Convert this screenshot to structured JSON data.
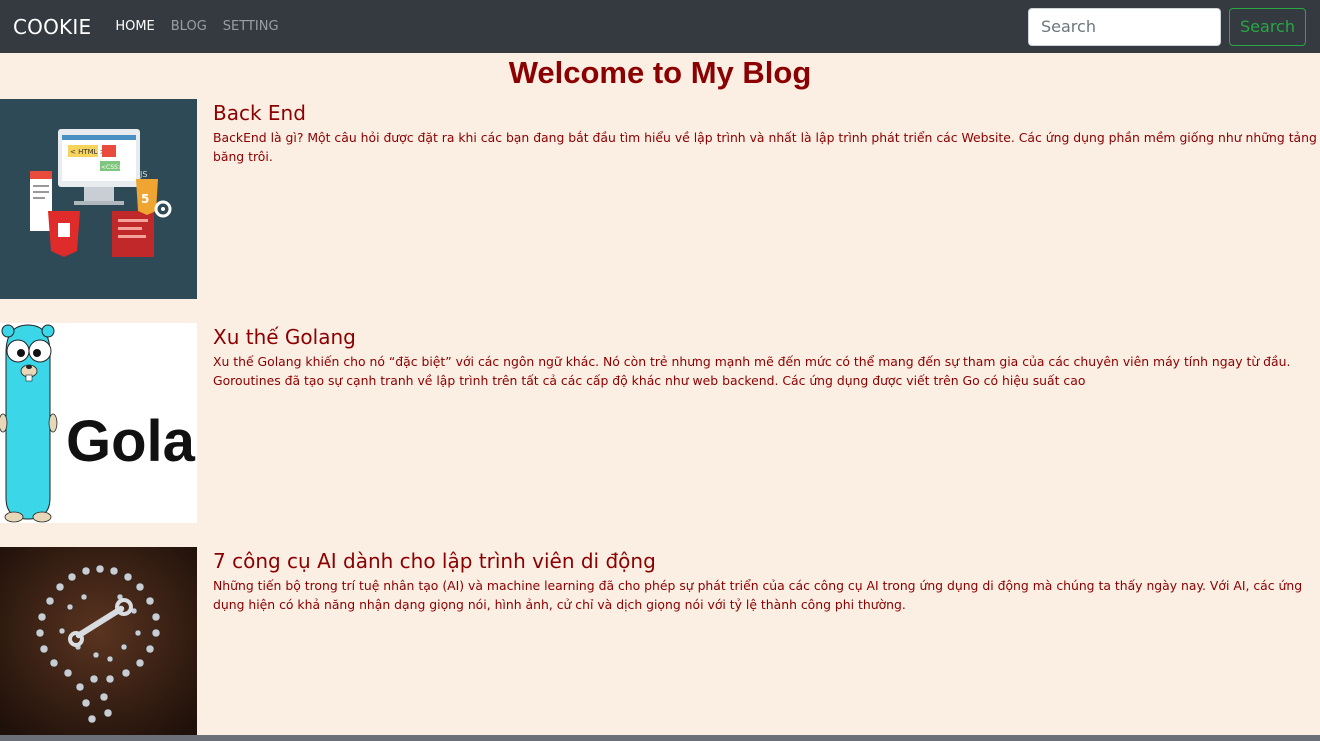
{
  "navbar": {
    "brand": "COOKIE",
    "links": [
      {
        "label": "HOME"
      },
      {
        "label": "BLOG"
      },
      {
        "label": "SETTING"
      }
    ],
    "search": {
      "placeholder": "Search",
      "button_label": "Search"
    }
  },
  "page_title": "Welcome to My Blog",
  "posts": [
    {
      "title": "Back End",
      "excerpt": "BackEnd là gì? Một câu hỏi được đặt ra khi các bạn đang bắt đầu tìm hiểu về lập trình và nhất là lập trình phát triển các Website. Các ứng dụng phần mềm giống như những tảng băng trôi.",
      "thumb_text": [
        "< HTML >",
        "<CSS>",
        "JS",
        "5"
      ]
    },
    {
      "title": "Xu thế Golang",
      "excerpt": "Xu thế Golang khiến cho nó “đặc biệt” với các ngôn ngữ khác. Nó còn trẻ nhưng mạnh mẽ đến mức có thể mang đến sự tham gia của các chuyên viên máy tính ngay từ đầu. Goroutines đã tạo sự cạnh tranh về lập trình trên tất cả các cấp độ khác như web backend. Các ứng dụng được viết trên Go có hiệu suất cao",
      "thumb_text": [
        "Golang"
      ]
    },
    {
      "title": "7 công cụ AI dành cho lập trình viên di động",
      "excerpt": "Những tiến bộ trong trí tuệ nhân tạo (AI) và machine learning đã cho phép sự phát triển của các công cụ AI trong ứng dụng di động mà chúng ta thấy ngày nay. Với AI, các ứng dụng hiện có khả năng nhận dạng giọng nói, hình ảnh, cử chỉ và dịch giọng nói với tỷ lệ thành công phi thường."
    }
  ],
  "colors": {
    "navbar_bg": "#343a40",
    "page_bg": "#fbeee3",
    "text": "#8b0000",
    "search_button": "#28a745"
  }
}
